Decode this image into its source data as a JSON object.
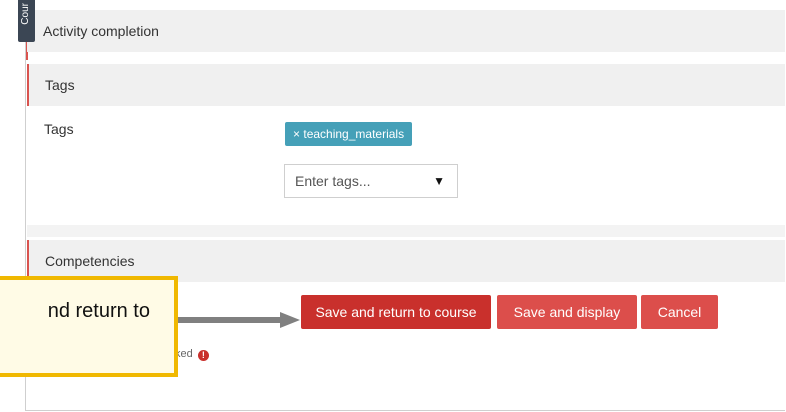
{
  "side_tab": {
    "label": "Cour"
  },
  "sections": {
    "activity_completion": "Activity completion",
    "tags_header": "Tags",
    "competencies_header": "Competencies"
  },
  "tags": {
    "field_label": "Tags",
    "selected": [
      {
        "remove_glyph": "×",
        "label": "teaching_materials"
      }
    ],
    "input_placeholder": "Enter tags...",
    "dropdown_glyph": "▼"
  },
  "buttons": {
    "save_return": "Save and return to course",
    "save_display": "Save and display",
    "cancel": "Cancel"
  },
  "required_note": {
    "text": "is form marked",
    "icon": "!"
  },
  "callout": {
    "text": "nd return to"
  },
  "colors": {
    "primary_button": "#c9302c",
    "secondary_button": "#dc4e4b",
    "tag_badge": "#45a0b8",
    "callout_border": "#f0b800",
    "section_accent": "#d9534f",
    "side_tab": "#3b4654"
  }
}
